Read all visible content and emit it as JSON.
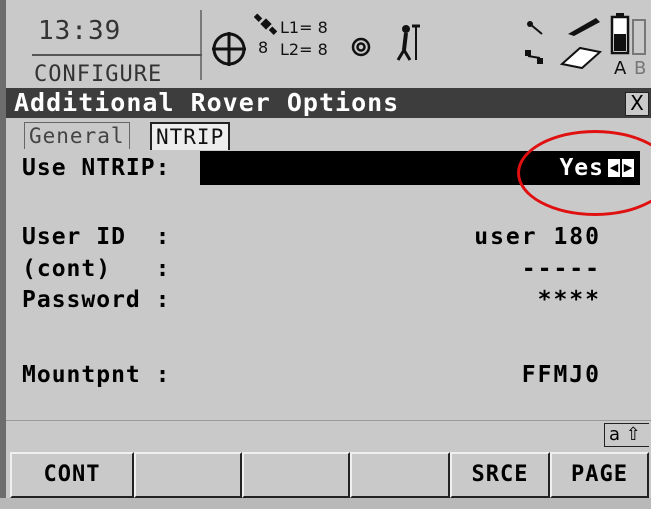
{
  "status": {
    "time": "13:39",
    "mode": "CONFIGURE",
    "satellites": "8",
    "l1": "L1= 8",
    "l2": "L2= 8",
    "battery_a": "A",
    "battery_b": "B"
  },
  "title": "Additional Rover Options",
  "close_label": "X",
  "tabs": [
    {
      "label": "General",
      "active": false
    },
    {
      "label": "NTRIP",
      "active": true
    }
  ],
  "fields": {
    "use_ntrip": {
      "label": "Use NTRIP:",
      "value": "Yes"
    },
    "user_id": {
      "label": "User ID  :",
      "value": "user 180"
    },
    "cont": {
      "label": "(cont)   :",
      "value": "-----"
    },
    "password": {
      "label": "Password :",
      "value": "****"
    },
    "mountpnt": {
      "label": "Mountpnt :",
      "value": "FFMJ0"
    }
  },
  "input_mode": "a ⇧",
  "softkeys": [
    "CONT",
    "",
    "",
    "",
    "SRCE",
    "PAGE"
  ],
  "colors": {
    "screen_bg": "#c9c9c9",
    "title_bg": "#3d3d3d",
    "highlight_circle": "#e01010"
  }
}
